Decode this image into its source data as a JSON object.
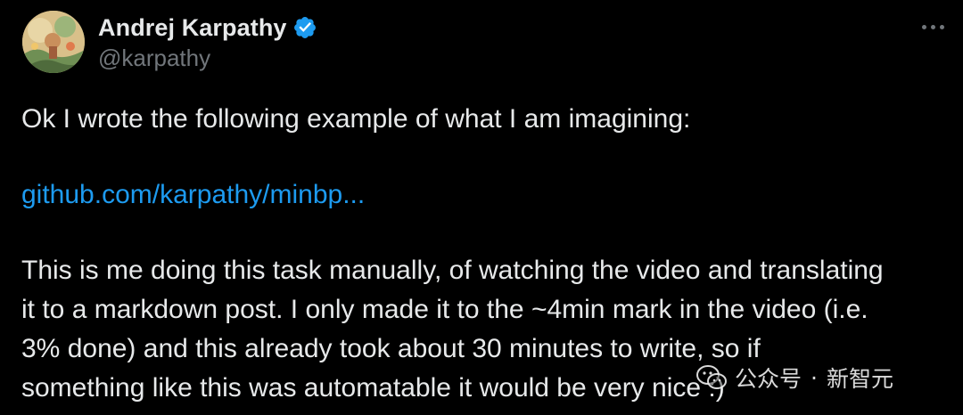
{
  "author": {
    "display_name": "Andrej Karpathy",
    "handle": "@karpathy",
    "verified_icon": "verified-badge-icon",
    "avatar_icon": "avatar-illustration"
  },
  "tweet": {
    "line1": "Ok I wrote the following example of what I am imagining:",
    "link_text": "github.com/karpathy/minbp...",
    "para2_line1": "This is me doing this task manually, of watching the video and translating",
    "para2_line2": "it to a markdown post. I only made it to the ~4min mark in the video (i.e.",
    "para2_line3": "3% done) and this already took about 30 minutes to write, so if",
    "para2_line4": "something like this was automatable it would be very nice :)"
  },
  "watermark": {
    "text_main": "公众号",
    "separator": "·",
    "text_brand": "新智元",
    "icon": "wechat-icon"
  },
  "colors": {
    "background": "#000000",
    "text": "#e7e9ea",
    "secondary": "#71767b",
    "link": "#1d9bf0",
    "verified": "#1d9bf0"
  }
}
